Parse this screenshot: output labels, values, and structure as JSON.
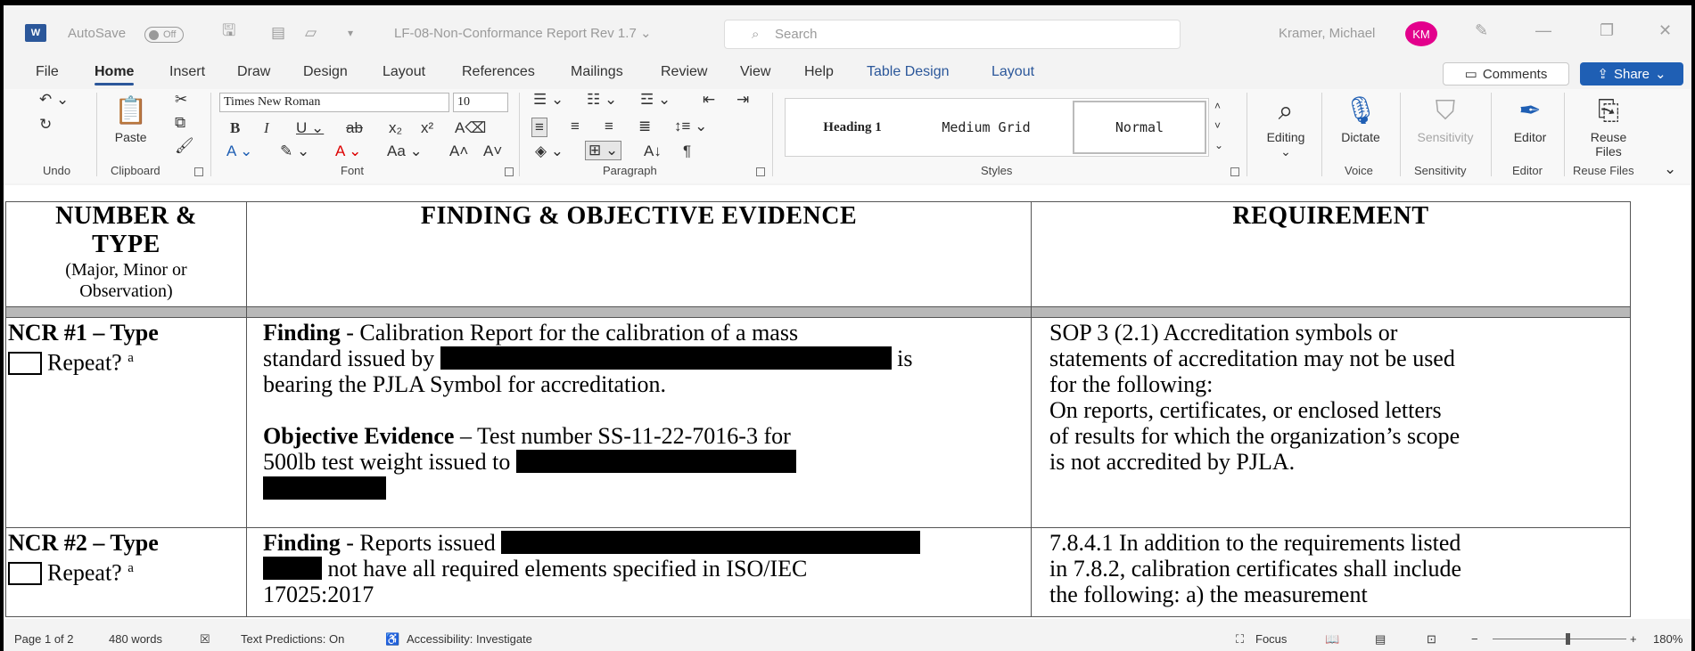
{
  "titlebar": {
    "app_icon": "word-logo-icon",
    "autosave_label": "AutoSave",
    "autosave_state": "Off",
    "doc_title": "LF-08-Non-Conformance Report Rev 1.7",
    "search_placeholder": "Search",
    "user_name": "Kramer, Michael",
    "user_initials": "KM",
    "avatar_color": "#e3008c"
  },
  "tabs": [
    "File",
    "Home",
    "Insert",
    "Draw",
    "Design",
    "Layout",
    "References",
    "Mailings",
    "Review",
    "View",
    "Help",
    "Table Design",
    "Layout"
  ],
  "active_tab": "Home",
  "actions": {
    "comments": "Comments",
    "share": "Share",
    "share_color": "#1f5fb4"
  },
  "ribbon": {
    "groups": [
      "Undo",
      "Clipboard",
      "Font",
      "Paragraph",
      "Styles",
      "Voice",
      "Sensitivity",
      "Editor",
      "Reuse Files"
    ],
    "paste_label": "Paste",
    "font_name": "Times New Roman",
    "font_size": "10",
    "styles": [
      "Heading 1",
      "Medium Grid",
      "Normal"
    ],
    "editing_label": "Editing",
    "dictate_label": "Dictate",
    "sensitivity_label": "Sensitivity",
    "editor_label": "Editor",
    "reuse_label_1": "Reuse",
    "reuse_label_2": "Files"
  },
  "document": {
    "headers": {
      "col1_line1": "NUMBER &",
      "col1_line2": "TYPE",
      "col1_sub1": "(Major, Minor or",
      "col1_sub2": "Observation)",
      "col2": "FINDING & OBJECTIVE EVIDENCE",
      "col3": "REQUIREMENT"
    },
    "rows": [
      {
        "number": "NCR #1 – Type",
        "repeat": "Repeat?",
        "repeat_note": "a",
        "finding_label": "Finding",
        "finding_l1": " - Calibration Report for the calibration of a mass",
        "finding_l2a": "standard issued by ",
        "finding_l2b": " is",
        "finding_l3": "bearing the PJLA Symbol for accreditation.",
        "evidence_label": "Objective Evidence",
        "evidence_l1": " – Test number SS-11-22-7016-3 for",
        "evidence_l2": "500lb test weight issued to ",
        "req_l1": "SOP 3 (2.1) Accreditation symbols or",
        "req_l2": "statements of accreditation may not be used",
        "req_l3": "for the following:",
        "req_l4": "On reports, certificates, or enclosed letters",
        "req_l5": "of results for which the organization’s scope",
        "req_l6": "is not accredited by PJLA."
      },
      {
        "number": "NCR #2 – Type",
        "repeat": "Repeat?",
        "repeat_note": "a",
        "finding_label": "Finding",
        "finding_l1": " - Reports issued ",
        "finding_l2": " not have all required elements specified in ISO/IEC",
        "finding_l3": "17025:2017",
        "req_l1": "7.8.4.1 In addition to the requirements listed",
        "req_l2": "in 7.8.2, calibration certificates shall include",
        "req_l3": "the following: a) the measurement"
      }
    ]
  },
  "statusbar": {
    "page": "Page 1 of 2",
    "words": "480 words",
    "predictions": "Text Predictions: On",
    "accessibility": "Accessibility: Investigate",
    "focus": "Focus",
    "zoom": "180%"
  }
}
